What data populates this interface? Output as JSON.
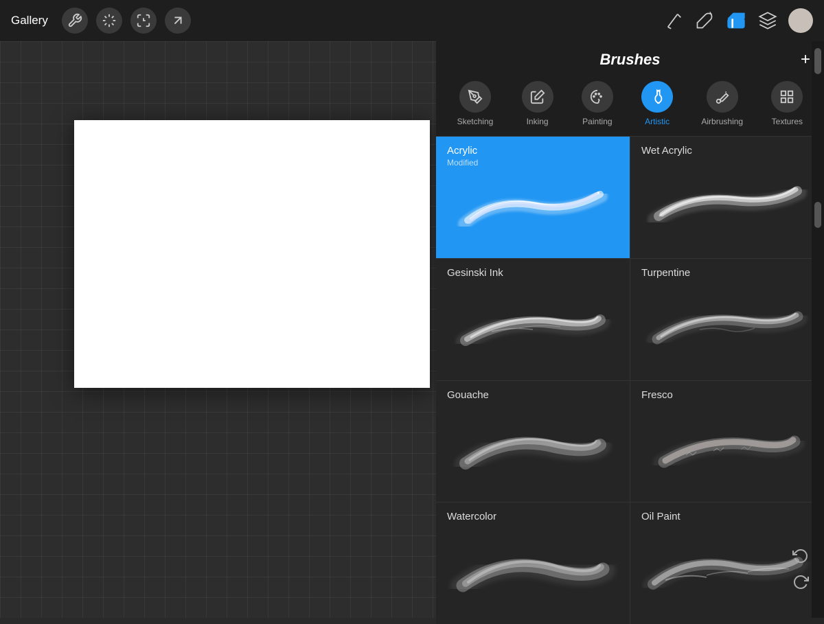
{
  "toolbar": {
    "gallery_label": "Gallery",
    "tools": [
      {
        "name": "wrench",
        "symbol": "🔧"
      },
      {
        "name": "magic",
        "symbol": "✦"
      },
      {
        "name": "transform",
        "symbol": "S"
      },
      {
        "name": "arrow",
        "symbol": "↗"
      }
    ],
    "right_tools": [
      {
        "name": "pen",
        "symbol": "pen"
      },
      {
        "name": "brush",
        "symbol": "brush"
      },
      {
        "name": "eraser",
        "symbol": "eraser"
      },
      {
        "name": "layers",
        "symbol": "layers"
      }
    ]
  },
  "brushes_panel": {
    "title": "Brushes",
    "add_label": "+",
    "categories": [
      {
        "id": "sketching",
        "label": "Sketching",
        "active": false
      },
      {
        "id": "inking",
        "label": "Inking",
        "active": false
      },
      {
        "id": "painting",
        "label": "Painting",
        "active": false
      },
      {
        "id": "artistic",
        "label": "Artistic",
        "active": true
      },
      {
        "id": "airbrushing",
        "label": "Airbrushing",
        "active": false
      },
      {
        "id": "textures",
        "label": "Textures",
        "active": false
      }
    ],
    "brushes": [
      {
        "id": "acrylic",
        "name": "Acrylic",
        "subtitle": "Modified",
        "selected": true,
        "col": 0
      },
      {
        "id": "wet-acrylic",
        "name": "Wet Acrylic",
        "subtitle": "",
        "selected": false,
        "col": 1
      },
      {
        "id": "gesinski-ink",
        "name": "Gesinski Ink",
        "subtitle": "",
        "selected": false,
        "col": 0
      },
      {
        "id": "turpentine",
        "name": "Turpentine",
        "subtitle": "",
        "selected": false,
        "col": 1
      },
      {
        "id": "gouache",
        "name": "Gouache",
        "subtitle": "",
        "selected": false,
        "col": 0
      },
      {
        "id": "fresco",
        "name": "Fresco",
        "subtitle": "",
        "selected": false,
        "col": 1
      },
      {
        "id": "watercolor",
        "name": "Watercolor",
        "subtitle": "",
        "selected": false,
        "col": 0
      },
      {
        "id": "oil-paint",
        "name": "Oil Paint",
        "subtitle": "",
        "selected": false,
        "col": 1
      }
    ]
  },
  "colors": {
    "selected_brush_bg": "#2196F3",
    "panel_bg": "#252525",
    "toolbar_bg": "#1e1e1e",
    "active_tool": "#2196F3"
  }
}
